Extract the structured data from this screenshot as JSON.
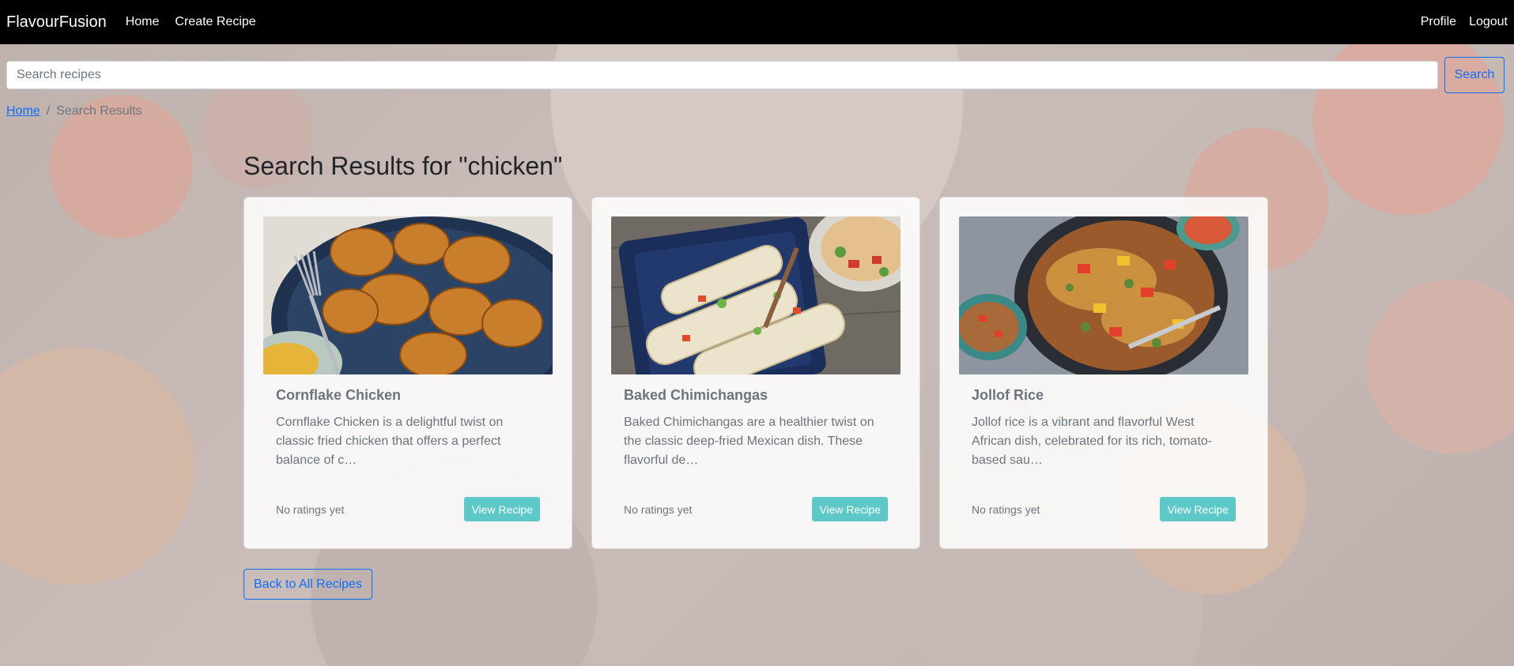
{
  "navbar": {
    "brand": "FlavourFusion",
    "links": [
      "Home",
      "Create Recipe"
    ],
    "right_links": [
      "Profile",
      "Logout"
    ]
  },
  "search": {
    "placeholder": "Search recipes",
    "button_label": "Search"
  },
  "breadcrumb": {
    "home": "Home",
    "separator": "/",
    "current": "Search Results"
  },
  "main": {
    "title": "Search Results for \"chicken\"",
    "recipes": [
      {
        "title": "Cornflake Chicken",
        "description": "Cornflake Chicken is a delightful twist on classic fried chicken that offers a perfect balance of c…",
        "rating": "No ratings yet",
        "button": "View Recipe"
      },
      {
        "title": "Baked Chimichangas",
        "description": "Baked Chimichangas are a healthier twist on the classic deep-fried Mexican dish. These flavorful de…",
        "rating": "No ratings yet",
        "button": "View Recipe"
      },
      {
        "title": "Jollof Rice",
        "description": "Jollof rice is a vibrant and flavorful West African dish, celebrated for its rich, tomato-based sau…",
        "rating": "No ratings yet",
        "button": "View Recipe"
      }
    ],
    "back_button": "Back to All Recipes"
  },
  "colors": {
    "navbar": "#000000",
    "primary": "#0d6efd",
    "view_button": "#5cc8c8"
  }
}
